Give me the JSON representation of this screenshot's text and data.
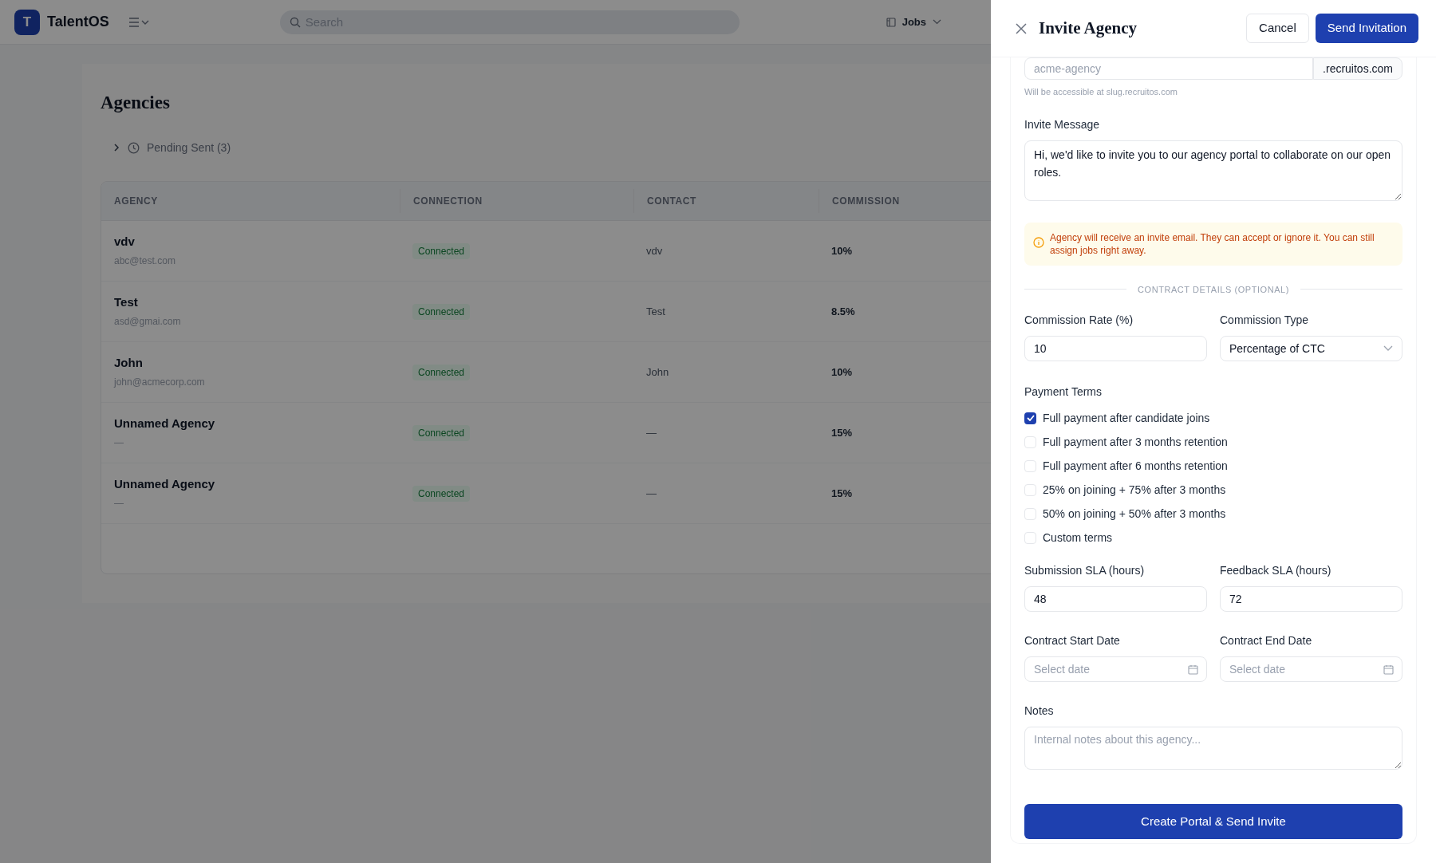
{
  "app": {
    "logo_letter": "T",
    "name": "TalentOS",
    "search": {
      "placeholder": "Search"
    },
    "nav": [
      {
        "label": "Jobs"
      }
    ]
  },
  "page": {
    "title": "Agencies",
    "pending": {
      "label": "Pending Sent (3)",
      "expanded": false
    },
    "table": {
      "columns": [
        "AGENCY",
        "CONNECTION",
        "CONTACT",
        "COMMISSION"
      ],
      "rows": [
        {
          "name": "vdv",
          "email": "abc@test.com",
          "connection": "Connected",
          "contact": "vdv",
          "commission": "10%"
        },
        {
          "name": "Test",
          "email": "asd@gmai.com",
          "connection": "Connected",
          "contact": "Test",
          "commission": "8.5%"
        },
        {
          "name": "John",
          "email": "john@acmecorp.com",
          "connection": "Connected",
          "contact": "John",
          "commission": "10%"
        },
        {
          "name": "Unnamed Agency",
          "email": "—",
          "connection": "Connected",
          "contact": "—",
          "commission": "15%"
        },
        {
          "name": "Unnamed Agency",
          "email": "—",
          "connection": "Connected",
          "contact": "—",
          "commission": "15%"
        }
      ]
    }
  },
  "drawer": {
    "title": "Invite Agency",
    "cancel": "Cancel",
    "send": "Send Invitation",
    "slug": {
      "placeholder": "acme-agency",
      "suffix": ".recruitos.com",
      "hint": "Will be accessible at slug.recruitos.com"
    },
    "message": {
      "label": "Invite Message",
      "value": "Hi, we'd like to invite you to our agency portal to collaborate on our open roles."
    },
    "alert": "Agency will receive an invite email. They can accept or ignore it. You can still assign jobs right away.",
    "section": "CONTRACT DETAILS (OPTIONAL)",
    "commission_rate": {
      "label": "Commission Rate (%)",
      "value": "10"
    },
    "commission_type": {
      "label": "Commission Type",
      "value": "Percentage of CTC"
    },
    "payment_terms": {
      "label": "Payment Terms",
      "options": [
        {
          "label": "Full payment after candidate joins",
          "checked": true
        },
        {
          "label": "Full payment after 3 months retention",
          "checked": false
        },
        {
          "label": "Full payment after 6 months retention",
          "checked": false
        },
        {
          "label": "25% on joining + 75% after 3 months",
          "checked": false
        },
        {
          "label": "50% on joining + 50% after 3 months",
          "checked": false
        },
        {
          "label": "Custom terms",
          "checked": false
        }
      ]
    },
    "submission_sla": {
      "label": "Submission SLA (hours)",
      "value": "48"
    },
    "feedback_sla": {
      "label": "Feedback SLA (hours)",
      "value": "72"
    },
    "start_date": {
      "label": "Contract Start Date",
      "placeholder": "Select date"
    },
    "end_date": {
      "label": "Contract End Date",
      "placeholder": "Select date"
    },
    "notes": {
      "label": "Notes",
      "placeholder": "Internal notes about this agency..."
    },
    "submit": "Create Portal & Send Invite"
  }
}
